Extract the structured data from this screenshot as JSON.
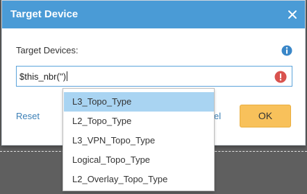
{
  "dialog": {
    "title": "Target Device",
    "close_icon": "close-icon",
    "field_label": "Target Devices:",
    "info_icon": "info-icon",
    "input_value": "$this_nbr('')",
    "error_icon": "error-icon",
    "reset_label": "Reset",
    "cancel_label_visible": "el",
    "ok_label": "OK"
  },
  "autocomplete": {
    "options": [
      {
        "label": "L3_Topo_Type",
        "selected": true
      },
      {
        "label": "L2_Topo_Type",
        "selected": false
      },
      {
        "label": "L3_VPN_Topo_Type",
        "selected": false
      },
      {
        "label": "Logical_Topo_Type",
        "selected": false
      },
      {
        "label": "L2_Overlay_Topo_Type",
        "selected": false
      }
    ]
  },
  "colors": {
    "titlebar": "#4a9bd6",
    "ok_button": "#f8c15b",
    "selected_option": "#a9d4f2",
    "link": "#3b7fb6",
    "error": "#d9534f",
    "info": "#3a87c8"
  }
}
